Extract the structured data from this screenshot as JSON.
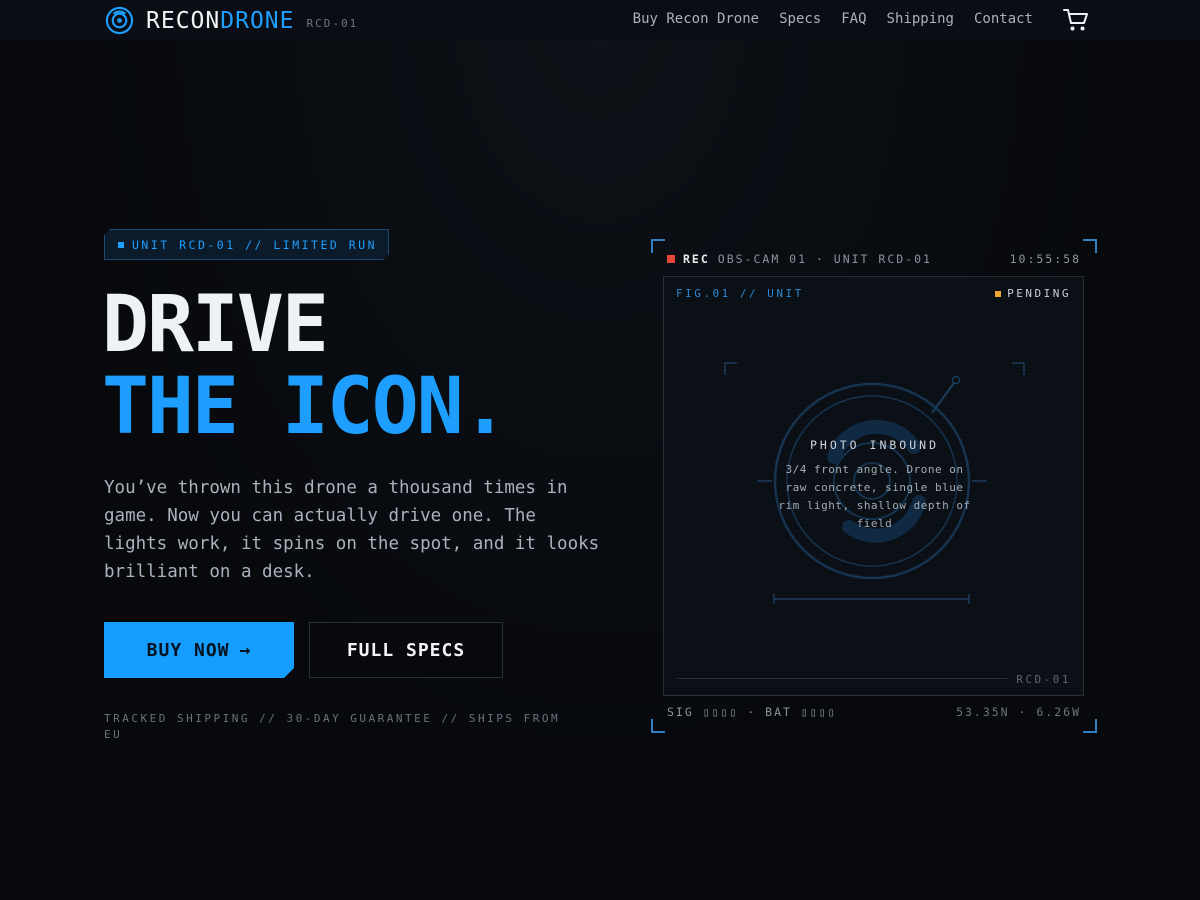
{
  "nav": {
    "logo_primary": "RECON",
    "logo_accent": "DRONE",
    "logo_code": "RCD-01",
    "links": [
      "Buy Recon Drone",
      "Specs",
      "FAQ",
      "Shipping",
      "Contact"
    ],
    "cart_icon": "cart-icon"
  },
  "hero": {
    "badge": "UNIT RCD-01 // LIMITED RUN",
    "headline_line1": "DRIVE",
    "headline_line2": "THE ICON.",
    "description": "You’ve thrown this drone a thousand times in game. Now you can actually drive one. The lights work, it spins on the spot, and it looks brilliant on a desk.",
    "buy_label": "BUY NOW",
    "buy_arrow": "→",
    "specs_label": "FULL SPECS",
    "trust_line": "TRACKED SHIPPING // 30-DAY GUARANTEE // SHIPS FROM EU"
  },
  "cam": {
    "rec_label": "REC",
    "feed_label": "OBS-CAM 01 · UNIT RCD-01",
    "timestamp": "10:55:58",
    "fig_label": "FIG.01 // UNIT",
    "status": "PENDING",
    "photo_title": "PHOTO INBOUND",
    "photo_desc": "3/4 front angle. Drone on raw concrete, single blue rim light, shallow depth of field",
    "frame_id": "RCD-01",
    "telemetry": "SIG ▯▯▯▯ · BAT ▯▯▯▯",
    "coords": "53.35N · 6.26W"
  },
  "colors": {
    "accent": "#1e9fff",
    "background": "#07090d",
    "rec": "#e5473a",
    "pending": "#f0a52b"
  }
}
